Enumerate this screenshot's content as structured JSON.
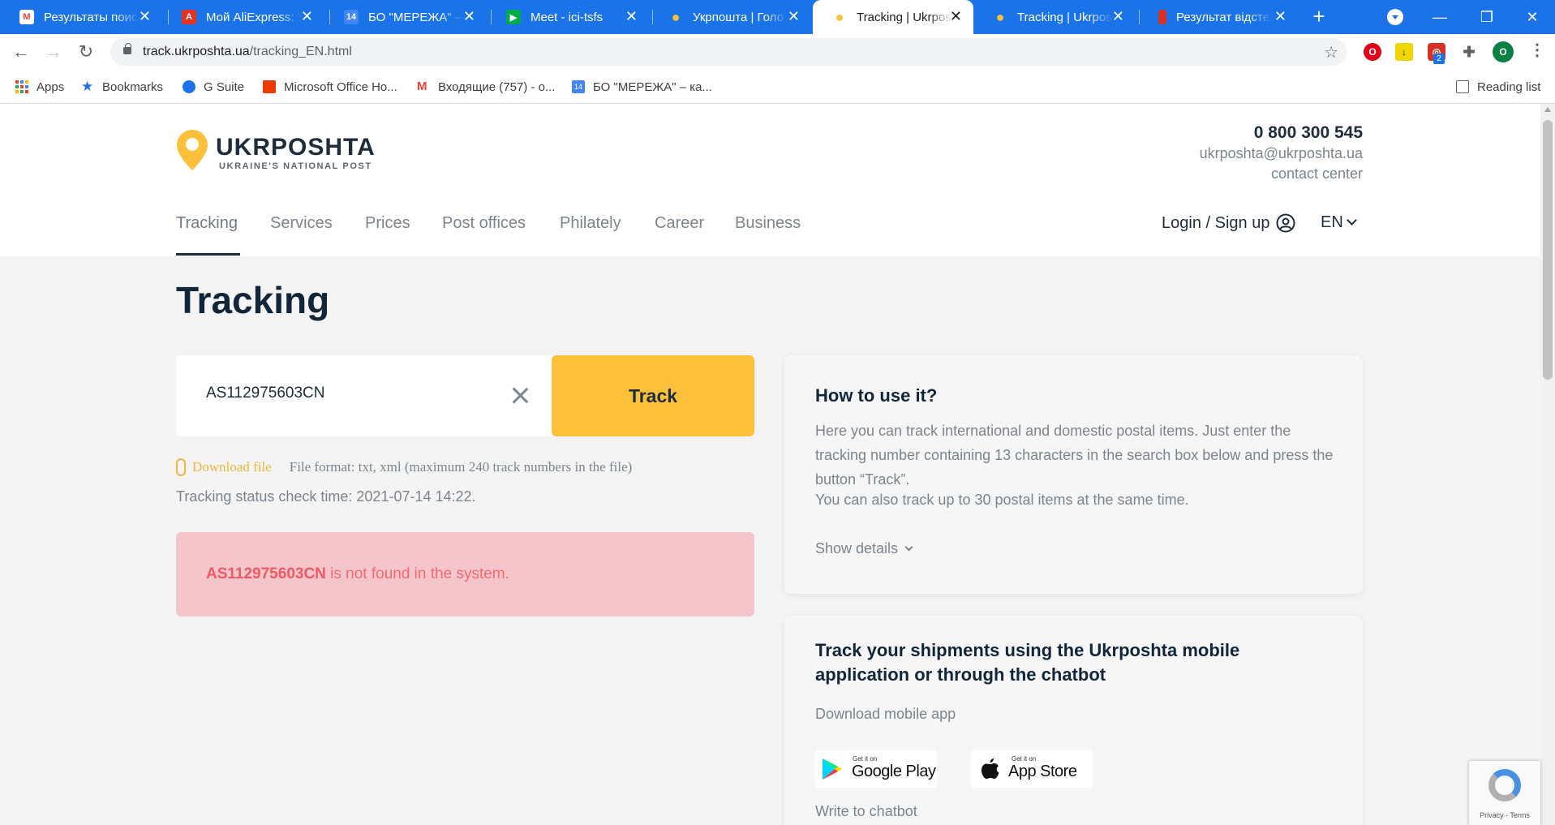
{
  "browser": {
    "tabs": [
      {
        "title": "Результаты поиск",
        "favicon": "gmail-icon",
        "color": "#ea4335"
      },
      {
        "title": "Мой AliExpress: У",
        "favicon": "aliexpress-icon",
        "color": "#e43225"
      },
      {
        "title": "БО \"МЕРЕЖА\" – к",
        "favicon": "calendar-icon",
        "color": "#4285f4"
      },
      {
        "title": "Meet - ici-tsfs",
        "favicon": "meet-icon",
        "color": "#00ac47"
      },
      {
        "title": "Укрпошта | Голо",
        "favicon": "ukrposhta-icon",
        "color": "#fdc03a"
      },
      {
        "title": "Tracking | Ukrpost",
        "favicon": "ukrposhta-icon",
        "color": "#fdc03a",
        "active": true
      },
      {
        "title": "Tracking | Ukrpost",
        "favicon": "ukrposhta-icon",
        "color": "#fdc03a"
      },
      {
        "title": "Результат відстеж",
        "favicon": "bookmark-icon",
        "color": "#d93025"
      }
    ],
    "new_tab": "+",
    "window_controls": {
      "minimize": "—",
      "maximize": "❐",
      "close": "✕"
    },
    "url": {
      "host": "track.ukrposhta.ua",
      "path": "/tracking_EN.html"
    },
    "extension_badge": "2",
    "profile_initial": "O",
    "bookmarks": [
      {
        "label": "Apps"
      },
      {
        "label": "Bookmarks"
      },
      {
        "label": "G Suite"
      },
      {
        "label": "Microsoft Office Ho..."
      },
      {
        "label": "Входящие (757) - o..."
      },
      {
        "label": "БО \"МЕРЕЖА\" – ка..."
      }
    ],
    "reading_list": "Reading list"
  },
  "header": {
    "logo_word": "UKRPOSHTA",
    "logo_sub": "UKRAINE'S NATIONAL POST",
    "phone": "0 800 300 545",
    "email": "ukrposhta@ukrposhta.ua",
    "contact": "contact center",
    "nav": [
      "Tracking",
      "Services",
      "Prices",
      "Post offices",
      "Philately",
      "Career",
      "Business"
    ],
    "login": "Login / Sign up",
    "lang": "EN"
  },
  "main": {
    "title": "Tracking",
    "search_value": "AS112975603CN",
    "track_button": "Track",
    "download_link": "Download file",
    "file_format": "File format: txt, xml (maximum 240 track numbers in the file)",
    "check_time": "Tracking status check time: 2021-07-14 14:22.",
    "alert_code": "AS112975603CN",
    "alert_text": " is not found in the system."
  },
  "how_to": {
    "title": "How to use it?",
    "p1": "Here you can track international and domestic postal items. Just enter the tracking number containing 13 characters in the search box below and press the button “Track”.",
    "p2": "You can also track up to 30 postal items at the same time.",
    "show_details": "Show details"
  },
  "mobile": {
    "title": "Track your shipments using the Ukrposhta mobile application or through the chatbot",
    "download_label": "Download mobile app",
    "google_small": "Get it on",
    "google_big": "Google Play",
    "apple_small": "Get it on",
    "apple_big": "App Store",
    "chatbot_label": "Write to chatbot"
  },
  "recaptcha": {
    "terms": "Privacy - Terms"
  },
  "colors": {
    "accent": "#fdc03a",
    "chrome": "#1a73e8",
    "alert_bg": "#f4c5cb",
    "alert_text": "#ee6b72",
    "dark": "#1d2d3c"
  }
}
